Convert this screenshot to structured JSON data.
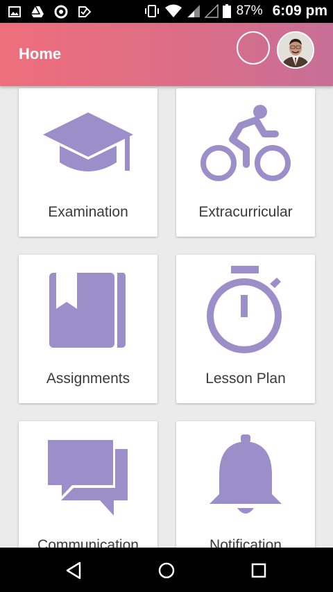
{
  "status_bar": {
    "battery": "87%",
    "time": "6:09 pm",
    "icons": [
      "gallery-icon",
      "drive-icon",
      "circle-app-icon",
      "check-app-icon",
      "vibrate-icon",
      "wifi-icon",
      "signal-icon",
      "signal-weak-icon",
      "battery-icon"
    ]
  },
  "app_bar": {
    "title": "Home"
  },
  "cards": [
    {
      "label": "Examination",
      "icon": "graduation-cap-icon"
    },
    {
      "label": "Extracurricular",
      "icon": "bicycle-icon"
    },
    {
      "label": "Assignments",
      "icon": "book-icon"
    },
    {
      "label": "Lesson Plan",
      "icon": "stopwatch-icon"
    },
    {
      "label": "Communication",
      "icon": "chat-icon"
    },
    {
      "label": "Notification",
      "icon": "bell-icon"
    }
  ],
  "nav_bar": {
    "buttons": [
      "back-icon",
      "home-icon",
      "recents-icon"
    ]
  },
  "colors": {
    "accent": "#9a8fc9",
    "app_bar_start": "#ee6f7c",
    "app_bar_end": "#c76f98"
  }
}
